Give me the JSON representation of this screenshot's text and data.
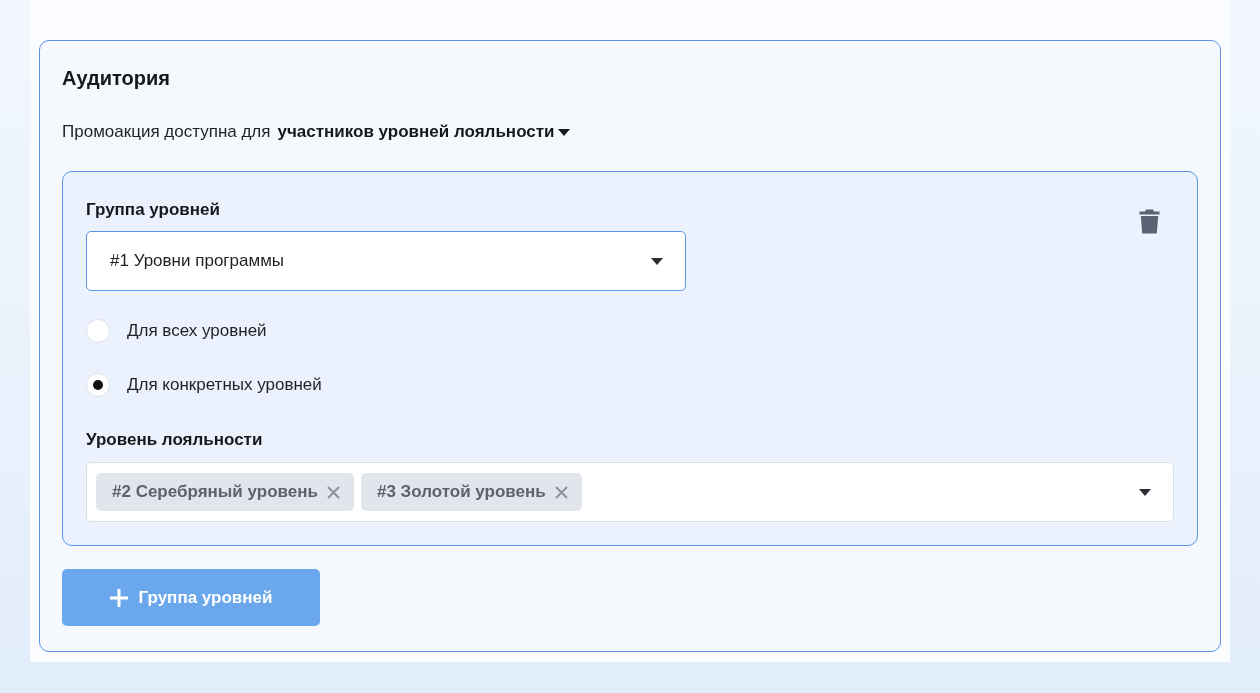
{
  "section": {
    "title": "Аудитория"
  },
  "availability": {
    "label": "Промоакция доступна для",
    "value": "участников уровней лояльности"
  },
  "level_groups": [
    {
      "group_label": "Группа уровней",
      "group_select": {
        "value": "#1 Уровни программы"
      },
      "scope_options": [
        {
          "label": "Для всех уровней",
          "selected": false
        },
        {
          "label": "Для конкретных уровней",
          "selected": true
        }
      ],
      "levels_label": "Уровень лояльности",
      "levels": [
        {
          "label": "#2 Серебряный уровень"
        },
        {
          "label": "#3 Золотой уровень"
        }
      ]
    }
  ],
  "add_button": {
    "label": "Группа уровней",
    "disabled": true
  }
}
